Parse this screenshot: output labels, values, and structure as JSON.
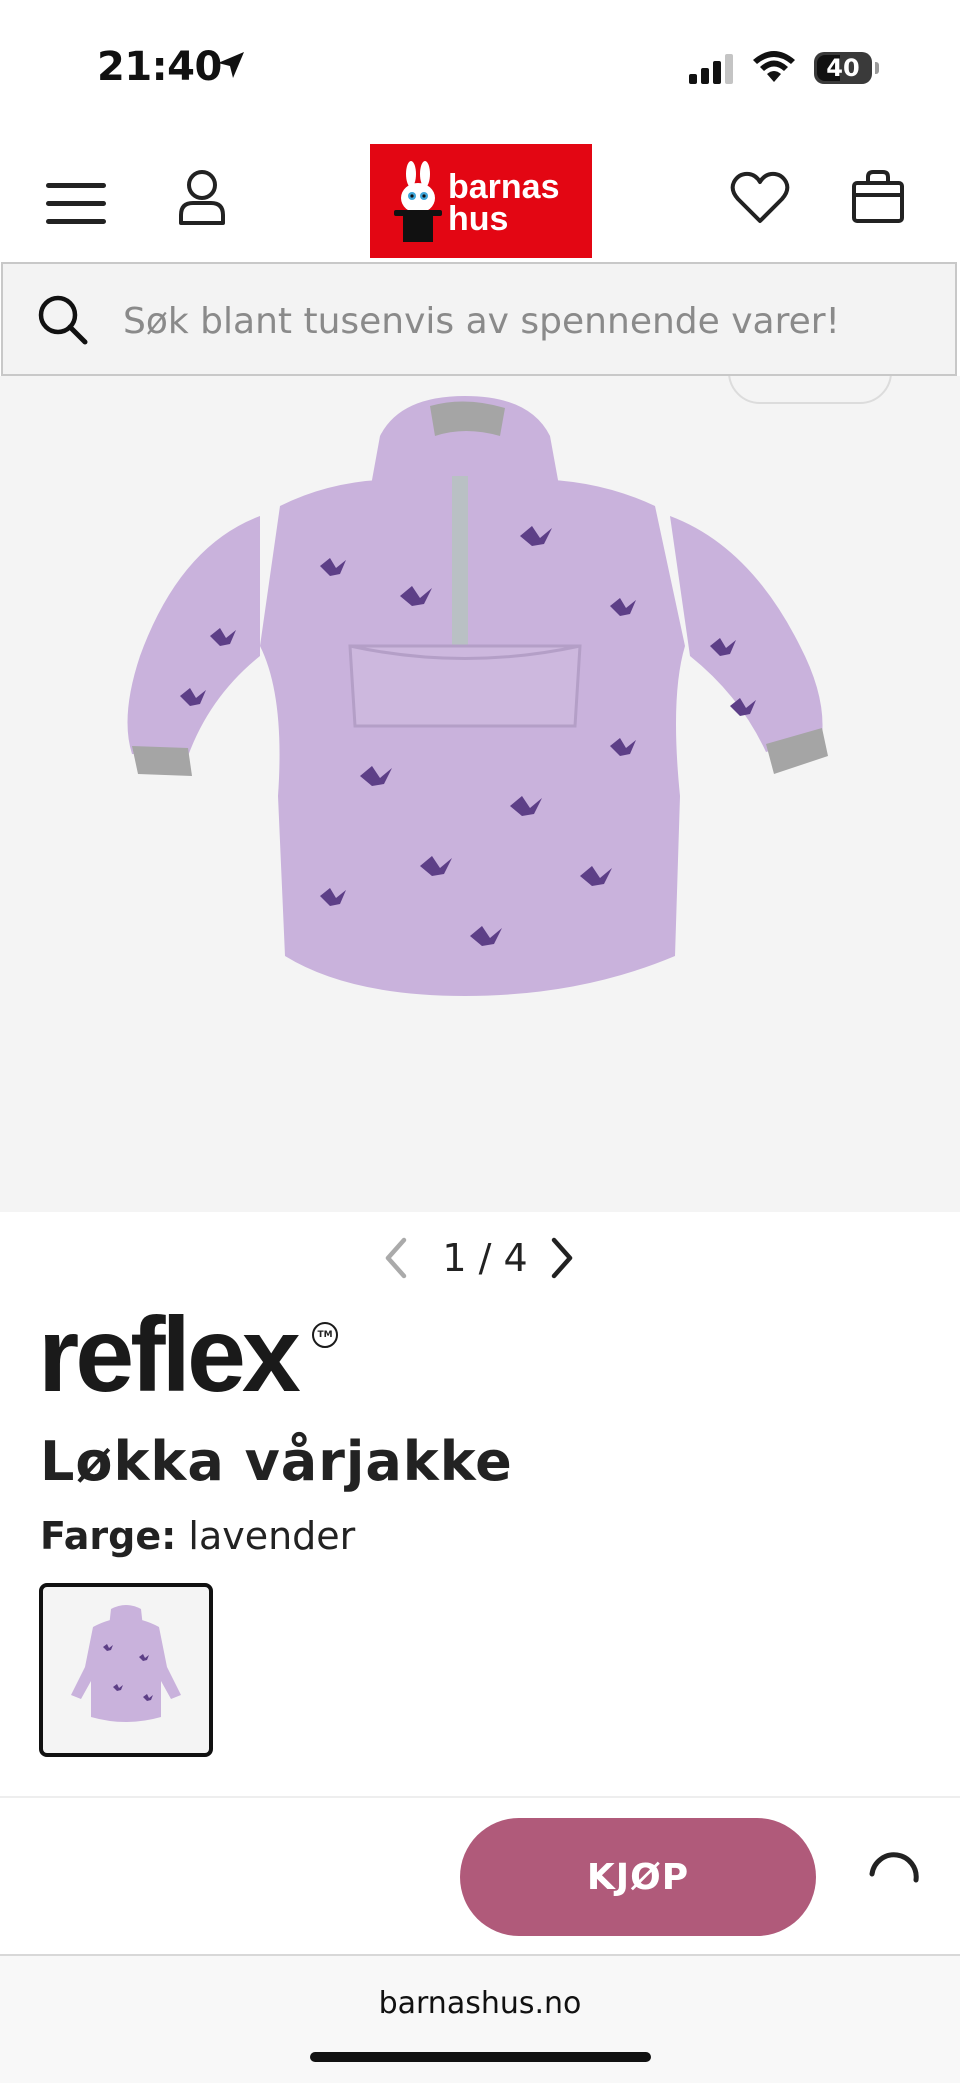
{
  "status_bar": {
    "time": "21:40",
    "battery": "40"
  },
  "header": {
    "logo_line1": "barnas",
    "logo_line2": "hus",
    "colors": {
      "logo_bg": "#e30613"
    }
  },
  "search": {
    "placeholder": "Søk blant tusenvis av spennende varer!"
  },
  "gallery": {
    "current": "1",
    "separator": "/",
    "total": "4"
  },
  "product": {
    "brand": "reflex",
    "brand_mark": "TM",
    "name": "Løkka vårjakke",
    "color_label": "Farge:",
    "color_value": "lavender",
    "colors": {
      "fabric": "#c9b2dc",
      "print": "#5d3f87"
    }
  },
  "buy_bar": {
    "buy_label": "KJØP",
    "colors": {
      "buy": "#b05a7a"
    }
  },
  "browser": {
    "url": "barnashus.no"
  }
}
